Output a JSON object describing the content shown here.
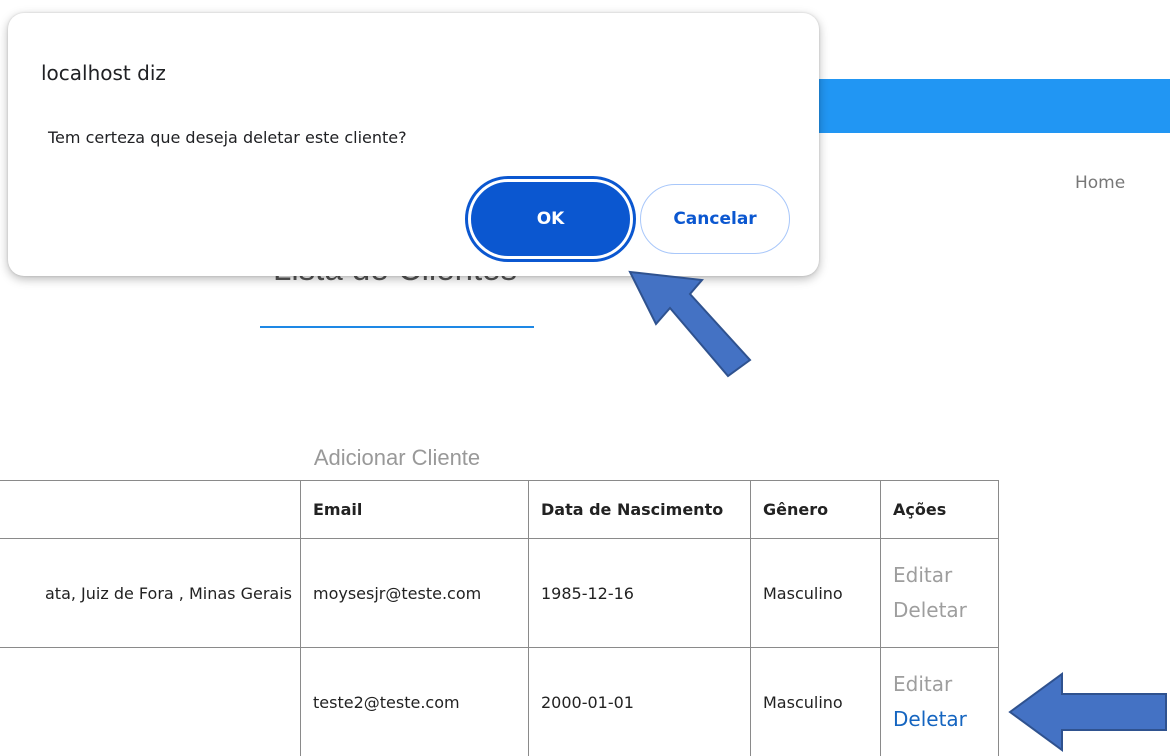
{
  "navbar": {
    "home_label": "Home",
    "accent_color": "#2196f3"
  },
  "page": {
    "title": "Lista de Clientes",
    "add_client_label": "Adicionar Cliente"
  },
  "table": {
    "headers": [
      "",
      "Email",
      "Data de Nascimento",
      "Gênero",
      "Ações"
    ],
    "rows": [
      {
        "address": "ata, Juiz de Fora , Minas Gerais",
        "email": "moysesjr@teste.com",
        "birth_date": "1985-12-16",
        "gender": "Masculino",
        "edit_label": "Editar",
        "delete_label": "Deletar"
      },
      {
        "address": "",
        "email": "teste2@teste.com",
        "birth_date": "2000-01-01",
        "gender": "Masculino",
        "edit_label": "Editar",
        "delete_label": "Deletar"
      }
    ]
  },
  "dialog": {
    "title": "localhost diz",
    "message": "Tem certeza que deseja deletar este cliente?",
    "ok_label": "OK",
    "cancel_label": "Cancelar"
  },
  "annotations": {
    "arrow_color": "#4472c4",
    "icons": [
      "arrow-to-ok-icon",
      "arrow-to-delete-icon"
    ]
  }
}
